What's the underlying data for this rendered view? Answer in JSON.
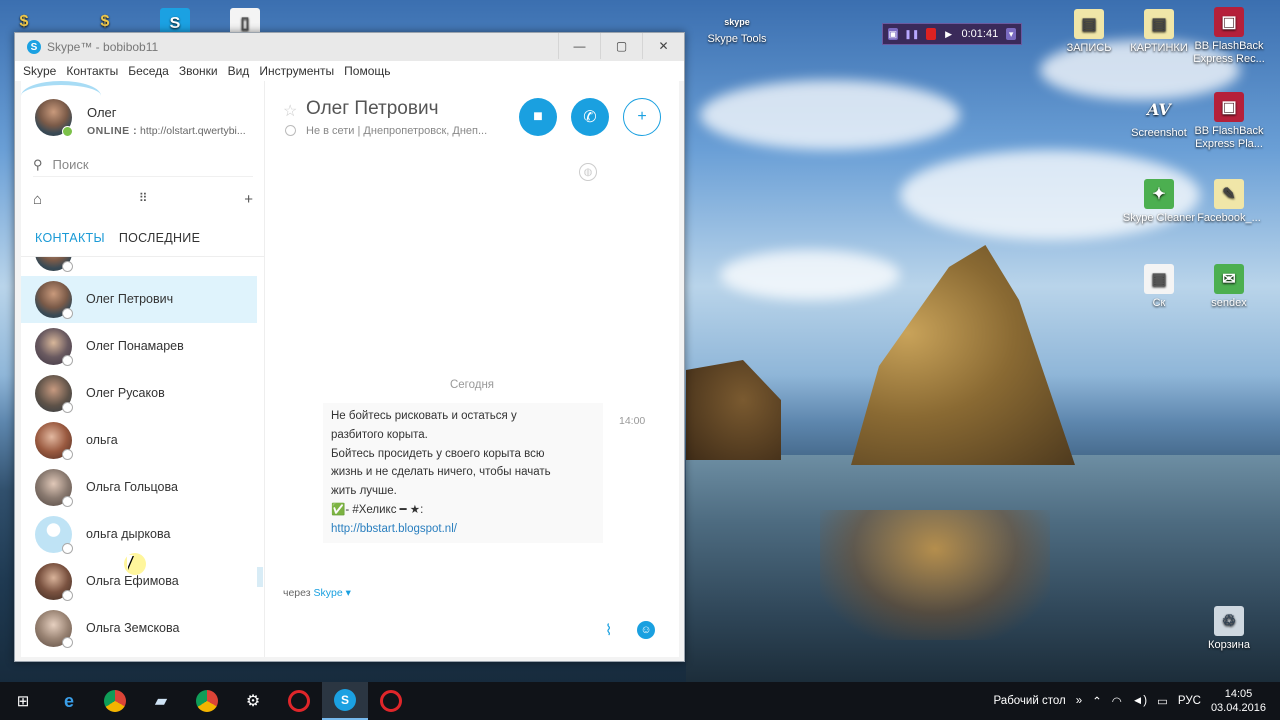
{
  "desktop": {
    "icons_left": [
      {
        "label": "",
        "glyph": "$"
      },
      {
        "label": "",
        "glyph": "$"
      },
      {
        "label": "",
        "glyph": "S"
      },
      {
        "label": "",
        "glyph": "▯"
      }
    ],
    "icons_right": [
      {
        "label": "Skype Tools",
        "glyph": "skype"
      },
      {
        "label": "ЗАПИСЬ",
        "glyph": "▤"
      },
      {
        "label": "КАРТИНКИ",
        "glyph": "▤"
      },
      {
        "label": "BB FlashBack Express Rec...",
        "glyph": "▣"
      },
      {
        "label": "Screenshot",
        "glyph": "AV"
      },
      {
        "label": "BB FlashBack Express Pla...",
        "glyph": "▣"
      },
      {
        "label": "Skype Cleaner",
        "glyph": "✦"
      },
      {
        "label": "Facebook_...",
        "glyph": "✎"
      },
      {
        "label": "Ск",
        "glyph": "▤"
      },
      {
        "label": "sendex",
        "glyph": "✉"
      },
      {
        "label": "Корзина",
        "glyph": "♲"
      }
    ],
    "recorder_time": "0:01:41"
  },
  "skype": {
    "window_title": "Skype™ - bobibob11",
    "window_buttons": {
      "minimize": "—",
      "maximize": "▢",
      "close": "✕"
    },
    "menu": [
      "Skype",
      "Контакты",
      "Беседа",
      "Звонки",
      "Вид",
      "Инструменты",
      "Помощь"
    ],
    "profile": {
      "name": "Олег",
      "status_label": "ONLINE :",
      "mood": "http://olstart.qwertybi..."
    },
    "search_placeholder": "Поиск",
    "tabs": {
      "contacts": "КОНТАКТЫ",
      "recent": "ПОСЛЕДНИЕ"
    },
    "contacts": [
      {
        "name": "Олег Петрович",
        "selected": true
      },
      {
        "name": "Олег Понамарев",
        "selected": false
      },
      {
        "name": "Олег Русаков",
        "selected": false
      },
      {
        "name": "ольга",
        "selected": false
      },
      {
        "name": "Ольга Гольцова",
        "selected": false
      },
      {
        "name": "ольга дыркова",
        "selected": false
      },
      {
        "name": "Ольга Ефимова",
        "selected": false
      },
      {
        "name": "Ольга Земскова",
        "selected": false
      }
    ],
    "chat": {
      "title": "Олег Петрович",
      "subtitle": "Не в сети  |  Днепропетровск, Днеп...",
      "day_label": "Сегодня",
      "message_lines": [
        "Не бойтесь рисковать и остаться у",
        "разбитого корыта.",
        "Бойтесь просидеть у своего корыта всю",
        "жизнь и не сделать ничего, чтобы начать",
        "жить лучше.",
        "✅- #Хеликс ━ ★:"
      ],
      "message_link": "http://bbstart.blogspot.nl/",
      "message_time": "14:00",
      "via_prefix": "через",
      "via_service": "Skype ▾"
    }
  },
  "taskbar": {
    "desktop_label": "Рабочий стол",
    "language": "РУС",
    "time": "14:05",
    "date": "03.04.2016"
  },
  "colors": {
    "skype_blue": "#1aa0e0",
    "selected_row": "#dff3fc",
    "online_green": "#7cc14a"
  }
}
